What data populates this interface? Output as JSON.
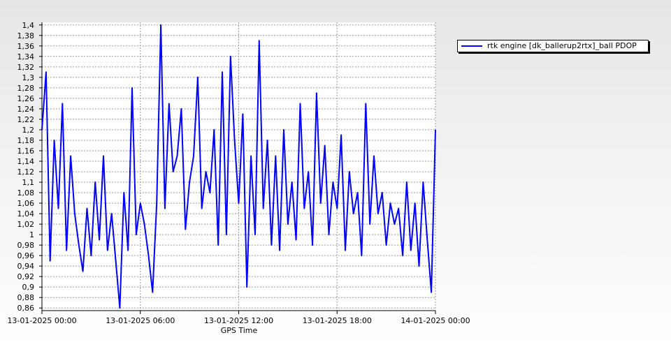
{
  "chart_data": {
    "type": "line",
    "title": "",
    "xlabel": "GPS Time",
    "ylabel": "",
    "x_ticks": [
      "13-01-2025 00:00",
      "13-01-2025 06:00",
      "13-01-2025 12:00",
      "13-01-2025 18:00",
      "14-01-2025 00:00"
    ],
    "xlim": [
      "2025-01-13T00:00",
      "2025-01-14T00:00"
    ],
    "y_ticks": [
      "0,86",
      "0,88",
      "0,9",
      "0,92",
      "0,94",
      "0,96",
      "0,98",
      "1",
      "1,02",
      "1,04",
      "1,06",
      "1,08",
      "1,1",
      "1,12",
      "1,14",
      "1,16",
      "1,18",
      "1,2",
      "1,22",
      "1,24",
      "1,26",
      "1,28",
      "1,3",
      "1,32",
      "1,34",
      "1,36",
      "1,38",
      "1,4"
    ],
    "ylim": [
      0.855,
      1.405
    ],
    "grid": true,
    "legend_position": "right",
    "series": [
      {
        "name": "rtk engine [dk_ballerup2rtx]_ball PDOP",
        "color": "#0000ff",
        "x_hours": [
          0,
          0.25,
          0.5,
          0.75,
          1,
          1.25,
          1.5,
          1.75,
          2,
          2.25,
          2.5,
          2.75,
          3,
          3.25,
          3.5,
          3.75,
          4,
          4.25,
          4.5,
          4.75,
          5,
          5.25,
          5.5,
          5.75,
          6,
          6.25,
          6.5,
          6.75,
          7,
          7.25,
          7.5,
          7.75,
          8,
          8.25,
          8.5,
          8.75,
          9,
          9.25,
          9.5,
          9.75,
          10,
          10.25,
          10.5,
          10.75,
          11,
          11.25,
          11.5,
          11.75,
          12,
          12.25,
          12.5,
          12.75,
          13,
          13.25,
          13.5,
          13.75,
          14,
          14.25,
          14.5,
          14.75,
          15,
          15.25,
          15.5,
          15.75,
          16,
          16.25,
          16.5,
          16.75,
          17,
          17.25,
          17.5,
          17.75,
          18,
          18.25,
          18.5,
          18.75,
          19,
          19.25,
          19.5,
          19.75,
          20,
          20.25,
          20.5,
          20.75,
          21,
          21.25,
          21.5,
          21.75,
          22,
          22.25,
          22.5,
          22.75,
          23,
          23.25,
          23.5,
          23.75,
          24
        ],
        "values": [
          1.2,
          1.31,
          0.95,
          1.18,
          1.05,
          1.25,
          0.97,
          1.15,
          1.04,
          0.98,
          0.93,
          1.05,
          0.96,
          1.1,
          0.99,
          1.15,
          0.97,
          1.04,
          0.95,
          0.86,
          1.08,
          0.97,
          1.28,
          1.0,
          1.06,
          1.02,
          0.96,
          0.89,
          1.06,
          1.4,
          1.05,
          1.25,
          1.12,
          1.15,
          1.24,
          1.01,
          1.1,
          1.15,
          1.3,
          1.05,
          1.12,
          1.08,
          1.2,
          0.98,
          1.31,
          1.0,
          1.34,
          1.18,
          1.06,
          1.23,
          0.9,
          1.15,
          1.0,
          1.37,
          1.05,
          1.18,
          0.98,
          1.15,
          0.97,
          1.2,
          1.02,
          1.1,
          0.99,
          1.25,
          1.05,
          1.12,
          0.98,
          1.27,
          1.06,
          1.17,
          1.0,
          1.1,
          1.05,
          1.19,
          0.97,
          1.12,
          1.04,
          1.08,
          0.96,
          1.25,
          1.02,
          1.15,
          1.04,
          1.08,
          0.98,
          1.06,
          1.02,
          1.05,
          0.96,
          1.1,
          0.97,
          1.06,
          0.94,
          1.1,
          0.99,
          0.89,
          1.2
        ]
      }
    ]
  }
}
